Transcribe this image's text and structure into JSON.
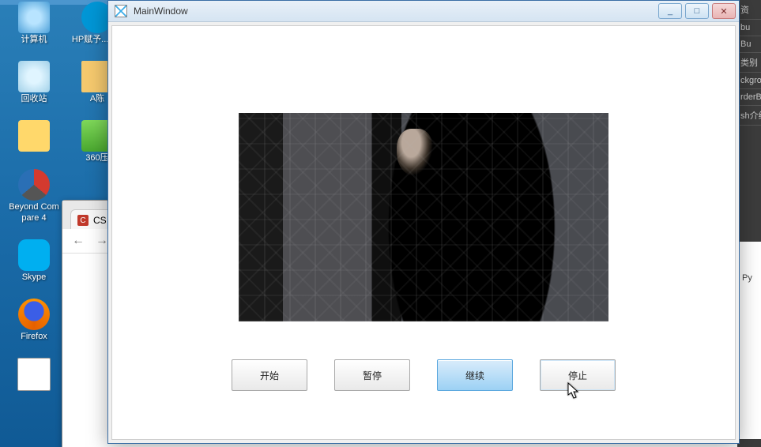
{
  "window": {
    "title": "MainWindow",
    "min_tip": "_",
    "max_tip": "□",
    "close_tip": "✕"
  },
  "buttons": {
    "start": "开始",
    "pause": "暂停",
    "resume": "继续",
    "stop": "停止"
  },
  "desktop": {
    "col1": [
      {
        "label": "计算机",
        "cls": "ic-pc"
      },
      {
        "label": "回收站",
        "cls": "ic-bin"
      },
      {
        "label": "",
        "cls": "ic-folder"
      },
      {
        "label": "Beyond Compare 4",
        "cls": "ic-bc"
      },
      {
        "label": "Skype",
        "cls": "ic-skype"
      },
      {
        "label": "Firefox",
        "cls": "ic-firefox"
      },
      {
        "label": "",
        "cls": "ic-txt"
      }
    ],
    "col2": [
      {
        "label": "HP赋予...exe",
        "cls": "ic-hp"
      },
      {
        "label": "A陈",
        "cls": "ic-xls"
      },
      {
        "label": "360压",
        "cls": "ic-zip"
      }
    ]
  },
  "browser": {
    "tab_text": "CS",
    "back": "←",
    "fwd": "→"
  },
  "right_panel": {
    "rows": [
      "资",
      "bu",
      "Bu",
      "类别",
      "ckgro",
      "rderB",
      "sh介绍"
    ],
    "white": "Py"
  }
}
